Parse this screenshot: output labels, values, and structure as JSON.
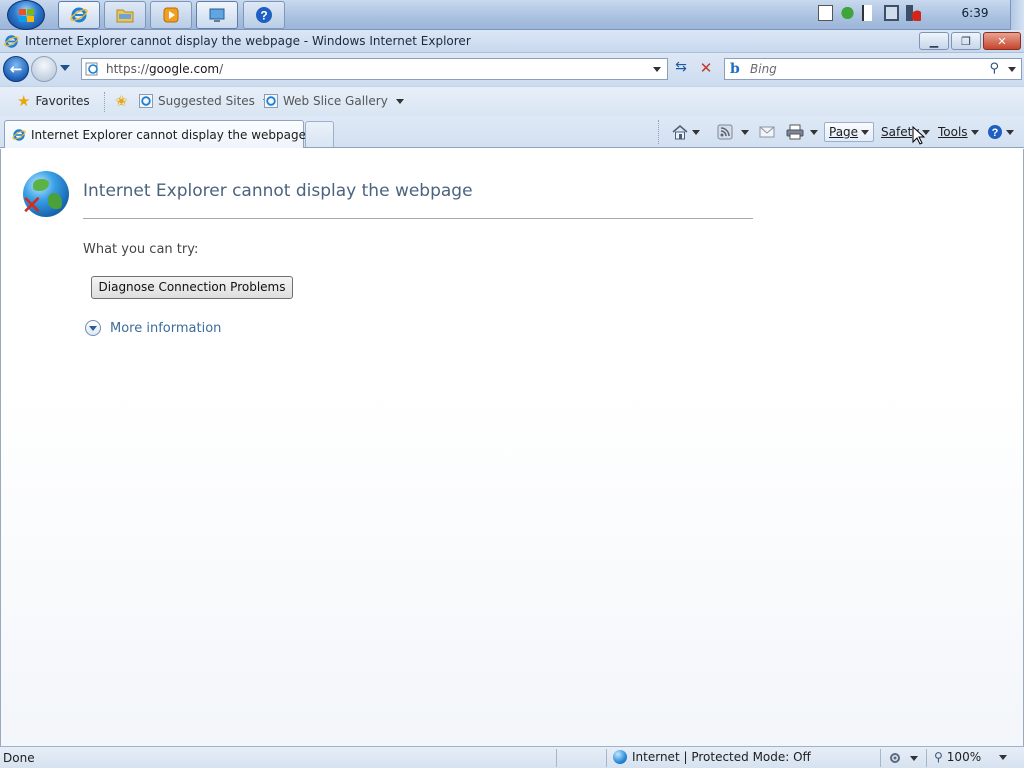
{
  "taskbar": {
    "clock": "6:39",
    "buttons": [
      {
        "name": "internet-explorer"
      },
      {
        "name": "windows-explorer"
      },
      {
        "name": "media-player"
      },
      {
        "name": "remote-desktop"
      },
      {
        "name": "help-and-support"
      }
    ]
  },
  "window": {
    "title": "Internet Explorer cannot display the webpage - Windows Internet Explorer"
  },
  "address_bar": {
    "url_prefix": "https://",
    "url_host": "google.com",
    "url_suffix": "/"
  },
  "search": {
    "placeholder": "Bing",
    "engine_glyph": "b"
  },
  "favorites_bar": {
    "favorites_label": "Favorites",
    "suggested_sites": "Suggested Sites",
    "web_slice_gallery": "Web Slice Gallery"
  },
  "tabs": [
    {
      "label": "Internet Explorer cannot display the webpage",
      "active": true
    }
  ],
  "command_bar": {
    "page_label": "Page",
    "safety_label": "Safety",
    "tools_label": "Tools"
  },
  "content": {
    "title": "Internet Explorer cannot display the webpage",
    "try_label": "What you can try:",
    "diagnose_button": "Diagnose Connection Problems",
    "more_information": "More information"
  },
  "status_bar": {
    "status": "Done",
    "zone": "Internet | Protected Mode: Off",
    "zoom": "100%"
  },
  "colors": {
    "accent": "#1c5fb8",
    "error_red": "#d42b1e",
    "link": "#3c6d9a",
    "title_text": "#4a6380"
  }
}
